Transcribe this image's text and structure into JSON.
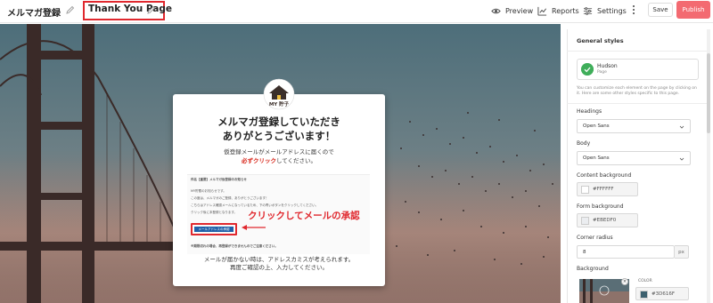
{
  "topbar": {
    "site_title": "メルマガ登録",
    "page_title": "Thank You Page",
    "actions": [
      {
        "label": "Preview",
        "icon": "eye-icon"
      },
      {
        "label": "Reports",
        "icon": "chart-icon"
      },
      {
        "label": "Settings",
        "icon": "sliders-icon"
      }
    ],
    "save_label": "Save",
    "publish_label": "Publish",
    "publish_color": "#F36A71",
    "highlight_color": "#E0282E"
  },
  "preview": {
    "logo_text": "MY 貯子",
    "headline_line1": "メルマガ登録していただき",
    "headline_line2": "ありがとうございます！",
    "sub_line1": "仮登録メールがメールアドレスに届くので",
    "sub_emphasis": "必ずクリック",
    "sub_rest": "してください。",
    "email_lines": [
      "件名【重要】メルマガ仮登録のお知らせ",
      "MY貯蓄のお知らせです。",
      "この度は、メルマガのご登録、ありがとうございます！",
      "こちらはアドレス確認メールになっているため、下の青いボタンをクリックしてください。",
      "クリック後に本登録となります。",
      "※期限切れの場合、再登録ができませんのでご注意ください。"
    ],
    "email_button_label": "メールアドレスの承認",
    "annotation": "クリックしてメールの承認",
    "footer_line1": "メールが届かない時は、アドレスカミスが考えられます。",
    "footer_line2": "再度ご確認の上、入力してください。"
  },
  "panel": {
    "heading": "General styles",
    "theme_name": "Hudson",
    "theme_type": "Page",
    "help_text": "You can customize each element on the page by clicking on it. Here are some other styles specific to this page.",
    "headings_label": "Headings",
    "headings_font": "Open Sans",
    "body_label": "Body",
    "body_font": "Open Sans",
    "content_bg_label": "Content background",
    "content_bg_value": "#FFFFFF",
    "form_bg_label": "Form background",
    "form_bg_value": "#EBEDF0",
    "corner_radius_label": "Corner radius",
    "corner_radius_value": "8",
    "corner_radius_unit": "px",
    "background_label": "Background",
    "background_color_label": "COLOR",
    "background_color_value": "#3D616F"
  }
}
